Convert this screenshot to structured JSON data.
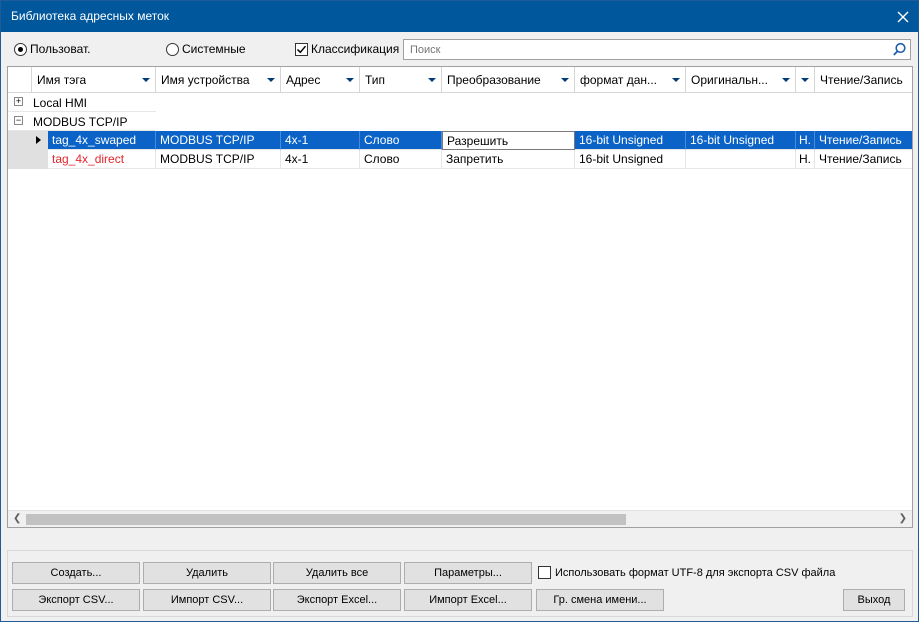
{
  "window": {
    "title": "Библиотека адресных меток"
  },
  "filters": {
    "user_label": "Пользоват.",
    "system_label": "Системные",
    "classification_label": "Классификация",
    "search_placeholder": "Поиск"
  },
  "columns": [
    {
      "label": "Имя тэга"
    },
    {
      "label": "Имя устройства"
    },
    {
      "label": "Адрес"
    },
    {
      "label": "Тип"
    },
    {
      "label": "Преобразование"
    },
    {
      "label": "формат дан..."
    },
    {
      "label": "Оригинальн..."
    },
    {
      "label": ""
    },
    {
      "label": "Чтение/Запись"
    }
  ],
  "groups": [
    {
      "label": "Local HMI",
      "expand": "+"
    },
    {
      "label": "MODBUS TCP/IP",
      "expand": "−"
    }
  ],
  "rows": [
    {
      "tag": "tag_4x_swaped",
      "device": "MODBUS TCP/IP",
      "address": "4x-1",
      "type": "Слово",
      "conversion": "Разрешить",
      "format": "16-bit Unsigned",
      "original": "16-bit Unsigned",
      "extra": "Н.",
      "rw": "Чтение/Запись"
    },
    {
      "tag": "tag_4x_direct",
      "device": "MODBUS TCP/IP",
      "address": "4x-1",
      "type": "Слово",
      "conversion": "Запретить",
      "format": "16-bit Unsigned",
      "original": "",
      "extra": "Н.",
      "rw": "Чтение/Запись"
    }
  ],
  "buttons": {
    "create": "Создать...",
    "delete": "Удалить",
    "delete_all": "Удалить все",
    "params": "Параметры...",
    "export_csv": "Экспорт CSV...",
    "import_csv": "Импорт CSV...",
    "export_excel": "Экспорт Excel...",
    "import_excel": "Импорт Excel...",
    "rename": "Гр. смена имени...",
    "exit": "Выход"
  },
  "utf8_option": {
    "label": "Использовать формат UTF-8 для экспорта CSV файла",
    "checked": false
  },
  "colors": {
    "titlebar": "#00579c",
    "selection": "#0b63c7",
    "error_text": "#e4262d"
  }
}
